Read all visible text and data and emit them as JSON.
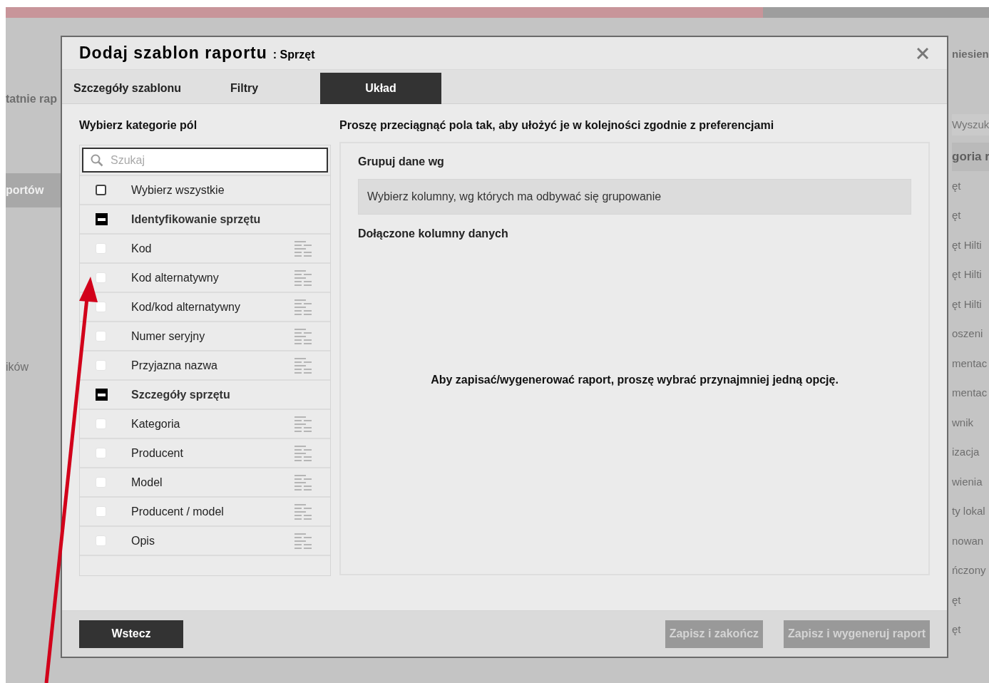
{
  "background": {
    "left_items": [
      {
        "label": "tatnie rap",
        "selected": false
      },
      {
        "label": "portów",
        "selected": true
      },
      {
        "label": "ików",
        "selected": false
      }
    ],
    "right_header": "niesien",
    "right_search_placeholder": "Wyszuk",
    "right_column_header": "goria r",
    "right_cells": [
      "ęt",
      "ęt",
      "ęt Hilti",
      "ęt Hilti",
      "ęt Hilti",
      "oszeni",
      "mentac",
      "mentac",
      "wnik",
      "izacja",
      "wienia",
      "ty lokal",
      "nowan",
      "ńczony",
      "ęt",
      "ęt"
    ]
  },
  "dialog": {
    "title": "Dodaj szablon raportu",
    "subtitle": ": Sprzęt",
    "tabs": [
      {
        "label": "Szczegóły szablonu",
        "selected": false
      },
      {
        "label": "Filtry",
        "selected": false
      },
      {
        "label": "Układ",
        "selected": true
      }
    ],
    "left_heading": "Wybierz kategorie pól",
    "search_placeholder": "Szukaj",
    "fields": [
      {
        "kind": "select_all",
        "label": "Wybierz wszystkie",
        "checked": false
      },
      {
        "kind": "group",
        "label": "Identyfikowanie sprzętu",
        "expanded": true
      },
      {
        "kind": "field",
        "label": "Kod",
        "checked": false
      },
      {
        "kind": "field",
        "label": "Kod alternatywny",
        "checked": false
      },
      {
        "kind": "field",
        "label": "Kod/kod alternatywny",
        "checked": false
      },
      {
        "kind": "field",
        "label": "Numer seryjny",
        "checked": false
      },
      {
        "kind": "field",
        "label": "Przyjazna nazwa",
        "checked": false
      },
      {
        "kind": "group",
        "label": "Szczegóły sprzętu",
        "expanded": true
      },
      {
        "kind": "field",
        "label": "Kategoria",
        "checked": false
      },
      {
        "kind": "field",
        "label": "Producent",
        "checked": false
      },
      {
        "kind": "field",
        "label": "Model",
        "checked": false
      },
      {
        "kind": "field",
        "label": "Producent / model",
        "checked": false
      },
      {
        "kind": "field",
        "label": "Opis",
        "checked": false
      }
    ],
    "right_heading": "Proszę przeciągnąć pola tak, aby ułożyć je w kolejności zgodnie z preferencjami",
    "group_heading": "Grupuj dane wg",
    "group_placeholder": "Wybierz kolumny, wg których ma odbywać się grupowanie",
    "columns_heading": "Dołączone kolumny danych",
    "message": "Aby zapisać/wygenerować raport, proszę wybrać przynajmniej jedną opcję.",
    "buttons": [
      {
        "label": "Wstecz",
        "kind": "back",
        "disabled": false
      },
      {
        "label": "Zapisz i zakończ",
        "kind": "save",
        "disabled": true
      },
      {
        "label": "Zapisz i wygeneruj raport",
        "kind": "save",
        "disabled": true
      }
    ]
  }
}
